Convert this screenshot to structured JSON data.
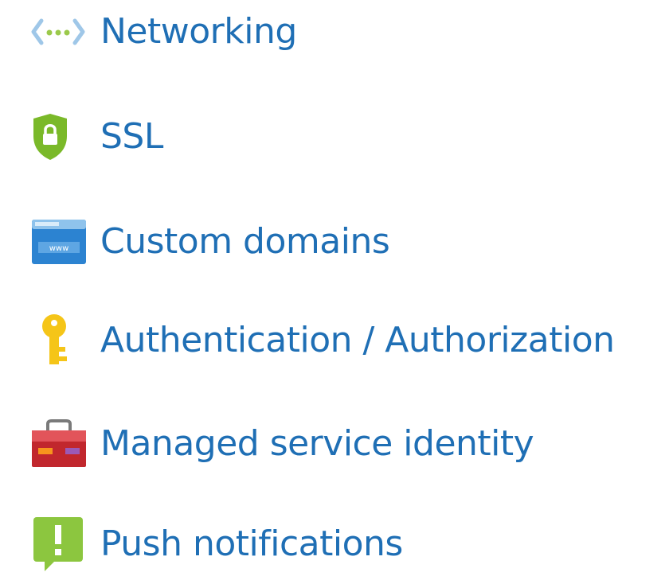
{
  "menu": {
    "items": [
      {
        "label": "Networking",
        "icon": "networking-icon"
      },
      {
        "label": "SSL",
        "icon": "ssl-shield-icon"
      },
      {
        "label": "Custom domains",
        "icon": "custom-domains-icon"
      },
      {
        "label": "Authentication / Authorization",
        "icon": "key-icon"
      },
      {
        "label": "Managed service identity",
        "icon": "toolbox-icon"
      },
      {
        "label": "Push notifications",
        "icon": "push-notification-icon"
      }
    ]
  },
  "colors": {
    "link_text": "#1f6fb5",
    "ssl_green": "#7ab929",
    "domain_blue": "#2c83d1",
    "key_yellow": "#f5c518",
    "toolbox_red": "#c1272d",
    "push_green": "#8cc63f"
  }
}
